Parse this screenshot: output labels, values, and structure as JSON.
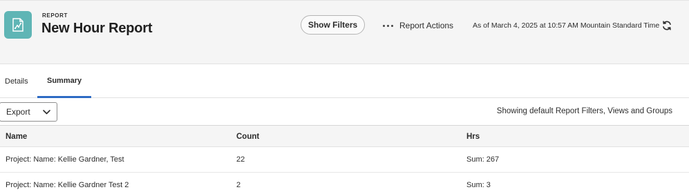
{
  "header": {
    "eyebrow": "REPORT",
    "title": "New Hour Report",
    "show_filters_label": "Show Filters",
    "report_actions_label": "Report Actions",
    "as_of_text": "As of March 4, 2025 at 10:57 AM Mountain Standard Time"
  },
  "tabs": [
    {
      "label": "Details",
      "active": false
    },
    {
      "label": "Summary",
      "active": true
    }
  ],
  "toolbar": {
    "export_label": "Export",
    "defaults_text": "Showing default Report Filters, Views and Groups"
  },
  "table": {
    "columns": [
      "Name",
      "Count",
      "Hrs"
    ],
    "rows": [
      {
        "name": "Project: Name: Kellie Gardner, Test",
        "count": "22",
        "hrs": "Sum: 267"
      },
      {
        "name": "Project: Name: Kellie Gardner Test 2",
        "count": "2",
        "hrs": "Sum: 3"
      }
    ]
  },
  "icons": [
    "report-icon",
    "ellipsis-icon",
    "refresh-icon",
    "chevron-down-icon"
  ],
  "colors": {
    "report_icon_bg": "#5fb5b5",
    "active_tab_underline": "#2d6bc4",
    "header_bg": "#f5f5f5"
  }
}
